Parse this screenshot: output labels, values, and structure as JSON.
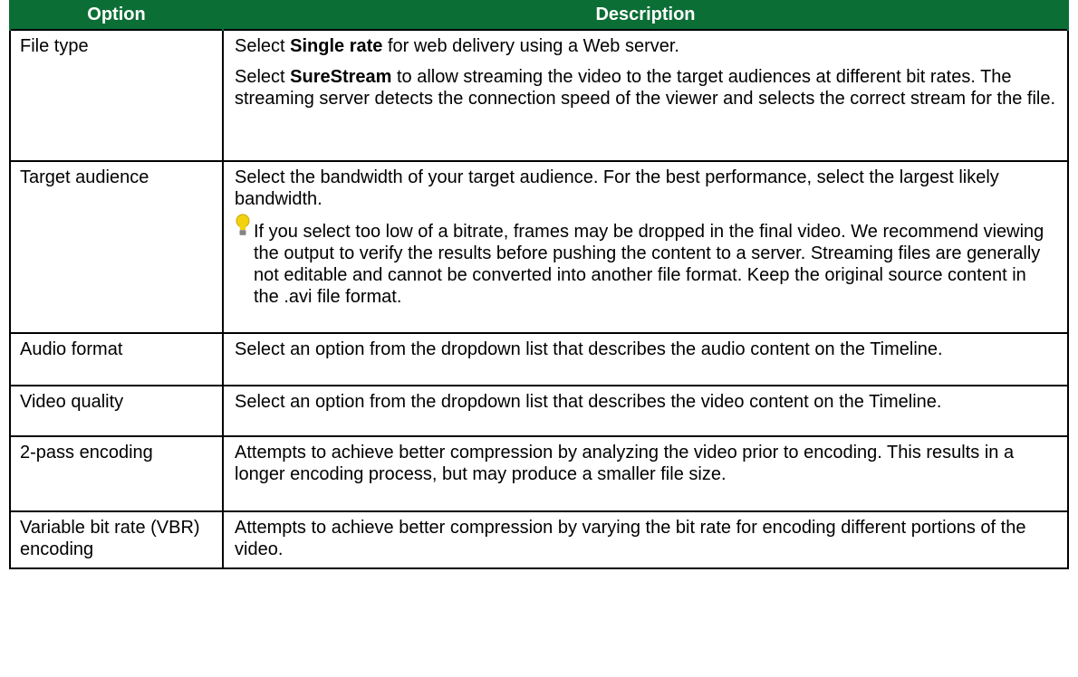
{
  "header": {
    "option": "Option",
    "description": "Description"
  },
  "rows": [
    {
      "option": "File type",
      "desc": [
        {
          "pre": "Select ",
          "bold": "Single rate",
          "post": " for web delivery using a Web server."
        },
        {
          "pre": "Select ",
          "bold": "SureStream",
          "post": " to allow streaming the video to the target audiences at different bit rates. The streaming server detects the connection speed of the viewer and selects the correct stream for the file."
        }
      ]
    },
    {
      "option": "Target audience",
      "desc": [
        {
          "text": "Select the bandwidth of your target audience. For the best performance, select the largest likely bandwidth."
        }
      ],
      "tip": {
        "icon": "lightbulb-icon",
        "text": "If you select too low of a bitrate, frames may be dropped in the final video. We recommend viewing the output to verify the results before pushing the content to a server. Streaming files are generally not editable and cannot be converted into another file format. Keep the original source content in the .avi file format."
      }
    },
    {
      "option": "Audio format",
      "desc": [
        {
          "text": "Select an option from the dropdown list that describes the audio content on the Timeline."
        }
      ]
    },
    {
      "option": "Video quality",
      "desc": [
        {
          "text": "Select an option from the dropdown list that describes the video content on the Timeline."
        }
      ]
    },
    {
      "option": "2-pass encoding",
      "desc": [
        {
          "text": "Attempts to achieve better compression by analyzing the video prior to encoding. This results in a longer encoding process, but may produce a smaller file size."
        }
      ]
    },
    {
      "option": "Variable bit rate (VBR) encoding",
      "desc": [
        {
          "text": "Attempts to achieve better compression by varying the bit rate for encoding different portions of the video."
        }
      ]
    }
  ],
  "colors": {
    "header_bg": "#0b6e35",
    "header_text": "#ffffff",
    "border": "#000000",
    "tip_bulb": "#f2d20c"
  }
}
